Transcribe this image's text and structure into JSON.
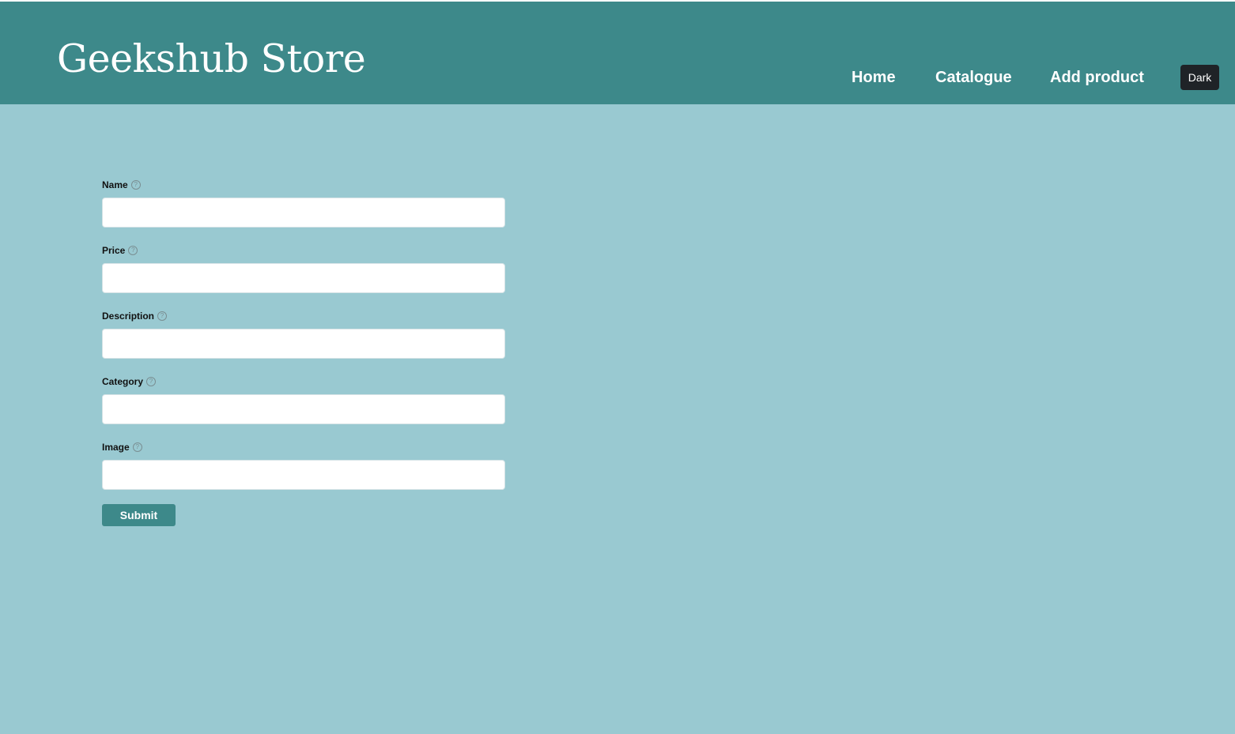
{
  "header": {
    "brand": "Geekshub Store",
    "nav": [
      {
        "label": "Home"
      },
      {
        "label": "Catalogue"
      },
      {
        "label": "Add product"
      }
    ],
    "theme_toggle_label": "Dark"
  },
  "form": {
    "fields": [
      {
        "label": "Name",
        "help_icon": "question-circle-icon",
        "value": ""
      },
      {
        "label": "Price",
        "help_icon": "question-circle-icon",
        "value": ""
      },
      {
        "label": "Description",
        "help_icon": "question-circle-icon",
        "value": ""
      },
      {
        "label": "Category",
        "help_icon": "question-circle-icon",
        "value": ""
      },
      {
        "label": "Image",
        "help_icon": "question-circle-icon",
        "value": ""
      }
    ],
    "submit_label": "Submit"
  },
  "colors": {
    "header_bg": "#3d898a",
    "page_bg": "#99c9d1",
    "theme_button_bg": "#1f2327",
    "submit_bg": "#3d898a"
  }
}
